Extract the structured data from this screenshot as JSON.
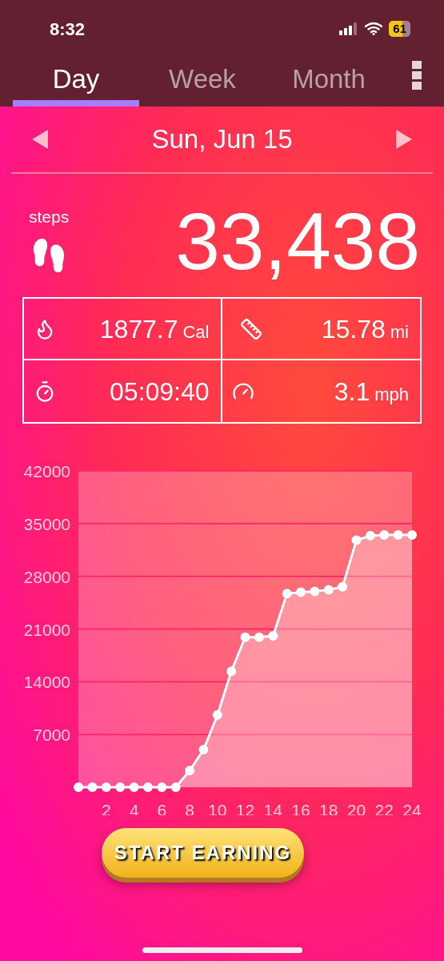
{
  "status_bar": {
    "time": "8:32",
    "battery": "61"
  },
  "tabs": [
    {
      "label": "Day",
      "selected": true
    },
    {
      "label": "Week",
      "selected": false
    },
    {
      "label": "Month",
      "selected": false
    }
  ],
  "date": "Sun, Jun 15",
  "steps": {
    "label": "steps",
    "value": "33,438"
  },
  "stats": [
    {
      "kind": "calories",
      "value": "1877.7",
      "unit": "Cal"
    },
    {
      "kind": "distance",
      "value": "15.78",
      "unit": "mi"
    },
    {
      "kind": "duration",
      "value": "05:09:40"
    },
    {
      "kind": "speed",
      "value": "3.1",
      "unit": "mph"
    }
  ],
  "chart_data": {
    "type": "area",
    "x": [
      0,
      1,
      2,
      3,
      4,
      5,
      6,
      7,
      8,
      9,
      10,
      11,
      12,
      13,
      14,
      15,
      16,
      17,
      18,
      19,
      20,
      21,
      22,
      23,
      24
    ],
    "series": [
      {
        "color": "#ffffff",
        "values": [
          0,
          0,
          0,
          0,
          0,
          0,
          0,
          0,
          2200,
          5000,
          9600,
          15400,
          19900,
          19900,
          20100,
          25700,
          25900,
          26000,
          26200,
          26600,
          32800,
          33400,
          33500,
          33500,
          33500
        ]
      }
    ],
    "grid": true,
    "xlim": [
      0,
      24
    ],
    "ylim": [
      0,
      42000
    ],
    "xticks": [
      2,
      4,
      6,
      8,
      10,
      12,
      14,
      16,
      18,
      20,
      22,
      24
    ],
    "yticks": [
      7000,
      14000,
      21000,
      28000,
      35000,
      42000
    ]
  },
  "cta_button": "START EARNING"
}
